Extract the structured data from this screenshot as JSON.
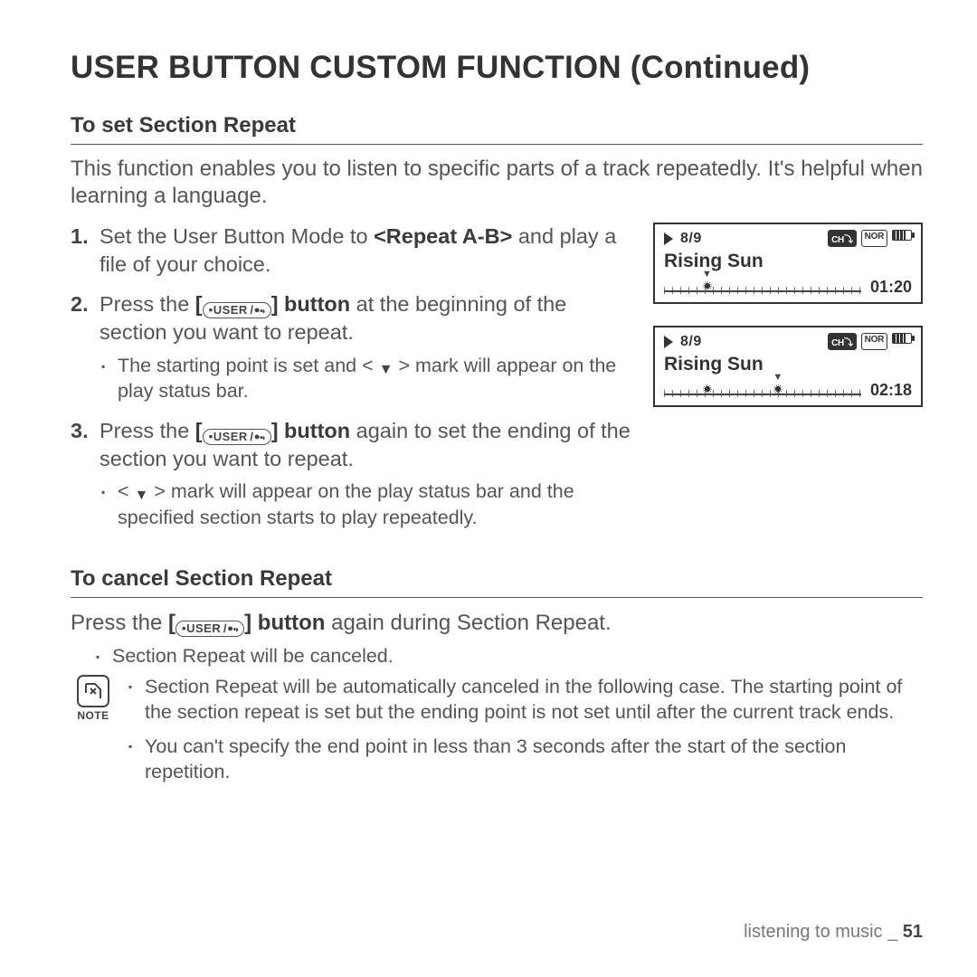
{
  "title": "USER BUTTON CUSTOM FUNCTION (Continued)",
  "section1": {
    "heading": "To set Section Repeat",
    "intro": "This function enables you to listen to specific parts of a track repeatedly. It's helpful when learning a language.",
    "step1_a": "Set the User Button Mode to ",
    "step1_b": "<Repeat A-B>",
    "step1_c": " and play a file of your choice.",
    "step2_a": "Press the ",
    "step2_b": " button",
    "step2_c": " at the beginning of the section you want to repeat.",
    "step2_sub_a": "The starting point is set and < ",
    "step2_sub_b": " > mark will appear on the play status bar.",
    "step3_a": "Press the ",
    "step3_b": " button",
    "step3_c": " again to set the ending of the section you want to repeat.",
    "step3_sub_a": "< ",
    "step3_sub_b": " > mark will appear on the play status bar and the specified section starts to play repeatedly."
  },
  "btn_label": "USER",
  "mock1": {
    "track": "8/9",
    "badge1": "CH⤵",
    "badge2": "NOR",
    "song": "Rising Sun",
    "time": "01:20"
  },
  "mock2": {
    "track": "8/9",
    "badge1": "CH⤵",
    "badge2": "NOR",
    "song": "Rising Sun",
    "time": "02:18"
  },
  "section2": {
    "heading": "To cancel Section Repeat",
    "line_a": "Press the ",
    "line_b": " button",
    "line_c": " again during Section Repeat.",
    "sub1": "Section Repeat will be canceled."
  },
  "note": {
    "label": "NOTE",
    "n1": "Section Repeat will be automatically canceled in the following case. The starting point of the section repeat is set but the ending point is not set until after the current track ends.",
    "n2": "You can't specify the end point in less than 3 seconds after the start of the section repetition."
  },
  "footer": {
    "text": "listening to music _ ",
    "page": "51"
  }
}
